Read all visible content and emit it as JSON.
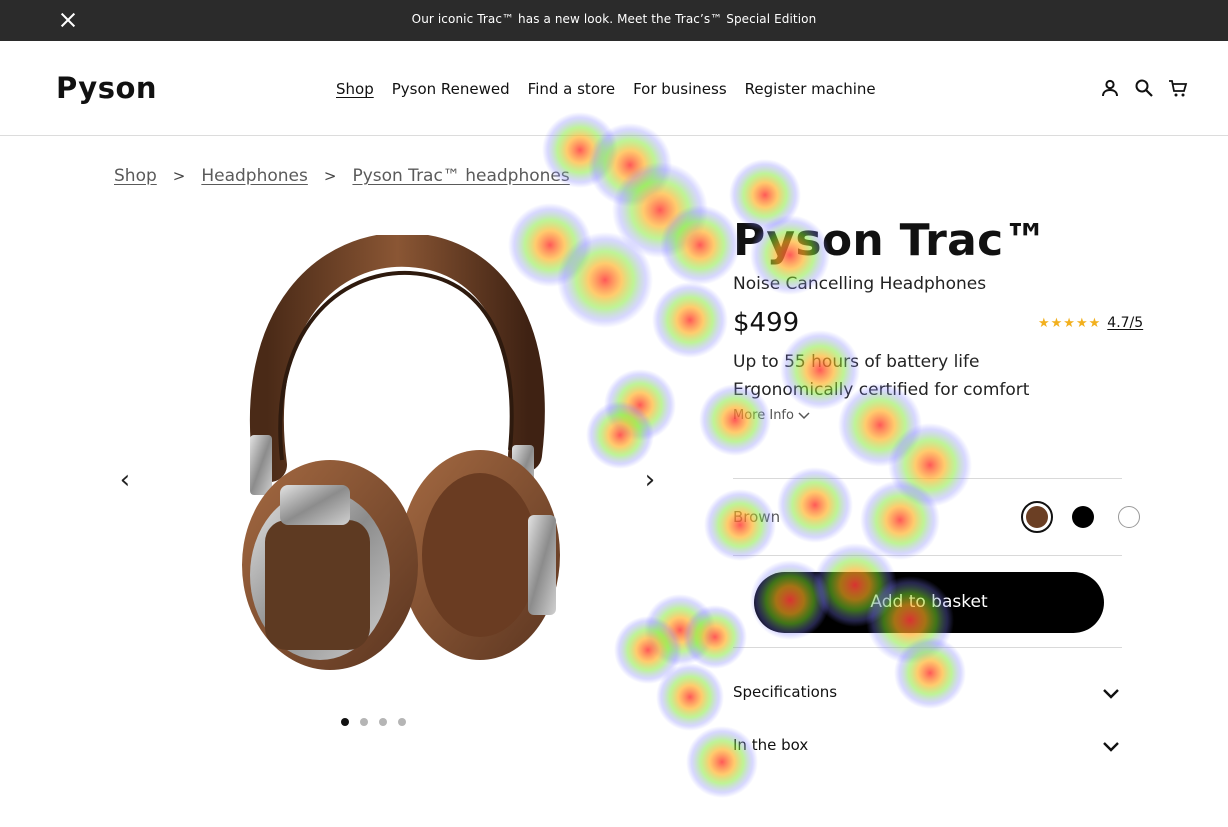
{
  "announcement": {
    "text": "Our iconic Trac™ has a new look. Meet the Trac’s™ Special Edition"
  },
  "header": {
    "logo": "Pyson",
    "nav": [
      "Shop",
      "Pyson Renewed",
      "Find a store",
      "For business",
      "Register machine"
    ]
  },
  "breadcrumb": [
    "Shop",
    "Headphones",
    "Pyson Trac™ headphones"
  ],
  "product": {
    "title": "Pyson Trac™",
    "subtitle": "Noise Cancelling Headphones",
    "price": "$499",
    "stars": "★★★★★",
    "rating": "4.7/5",
    "features": [
      "Up to 55 hours of battery life",
      "Ergonomically certified for comfort"
    ],
    "more_info": "More Info",
    "color_label": "Brown",
    "colors": [
      "#6b3f24",
      "#000000",
      "#ffffff"
    ],
    "add_to_basket": "Add to basket",
    "accordions": [
      "Specifications",
      "In the box"
    ]
  },
  "gallery": {
    "prev": "‹",
    "next": "›",
    "slide_count": 4,
    "active_slide": 1
  }
}
